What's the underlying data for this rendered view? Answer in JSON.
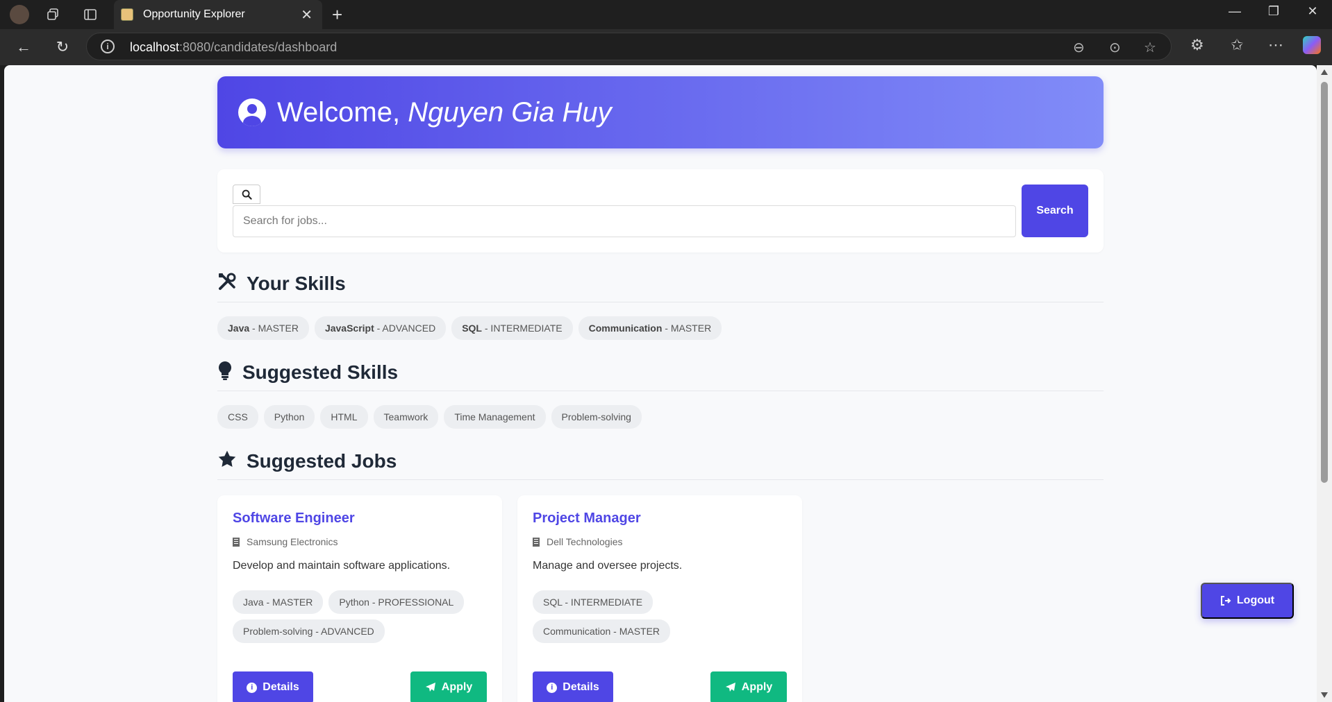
{
  "browser": {
    "tab_title": "Opportunity Explorer",
    "url_host": "localhost",
    "url_rest": ":8080/candidates/dashboard"
  },
  "welcome": {
    "prefix": "Welcome, ",
    "name": "Nguyen Gia Huy"
  },
  "search": {
    "placeholder": "Search for jobs...",
    "button_label": "Search"
  },
  "skills": {
    "title": "Your Skills",
    "items": [
      {
        "name": "Java",
        "level": " - MASTER"
      },
      {
        "name": "JavaScript",
        "level": " - ADVANCED"
      },
      {
        "name": "SQL",
        "level": " - INTERMEDIATE"
      },
      {
        "name": "Communication",
        "level": " - MASTER"
      }
    ]
  },
  "suggested_skills": {
    "title": "Suggested Skills",
    "items": [
      "CSS",
      "Python",
      "HTML",
      "Teamwork",
      "Time Management",
      "Problem-solving"
    ]
  },
  "suggested_jobs": {
    "title": "Suggested Jobs",
    "jobs": [
      {
        "title": "Software Engineer",
        "company": "Samsung Electronics",
        "description": "Develop and maintain software applications.",
        "skills": [
          "Java - MASTER",
          "Python - PROFESSIONAL",
          "Problem-solving - ADVANCED"
        ],
        "details_label": "Details",
        "apply_label": "Apply"
      },
      {
        "title": "Project Manager",
        "company": "Dell Technologies",
        "description": "Manage and oversee projects.",
        "skills": [
          "SQL - INTERMEDIATE",
          "Communication - MASTER"
        ],
        "details_label": "Details",
        "apply_label": "Apply"
      }
    ]
  },
  "logout_label": "Logout",
  "colors": {
    "primary": "#4f46e5",
    "success": "#10b981"
  }
}
